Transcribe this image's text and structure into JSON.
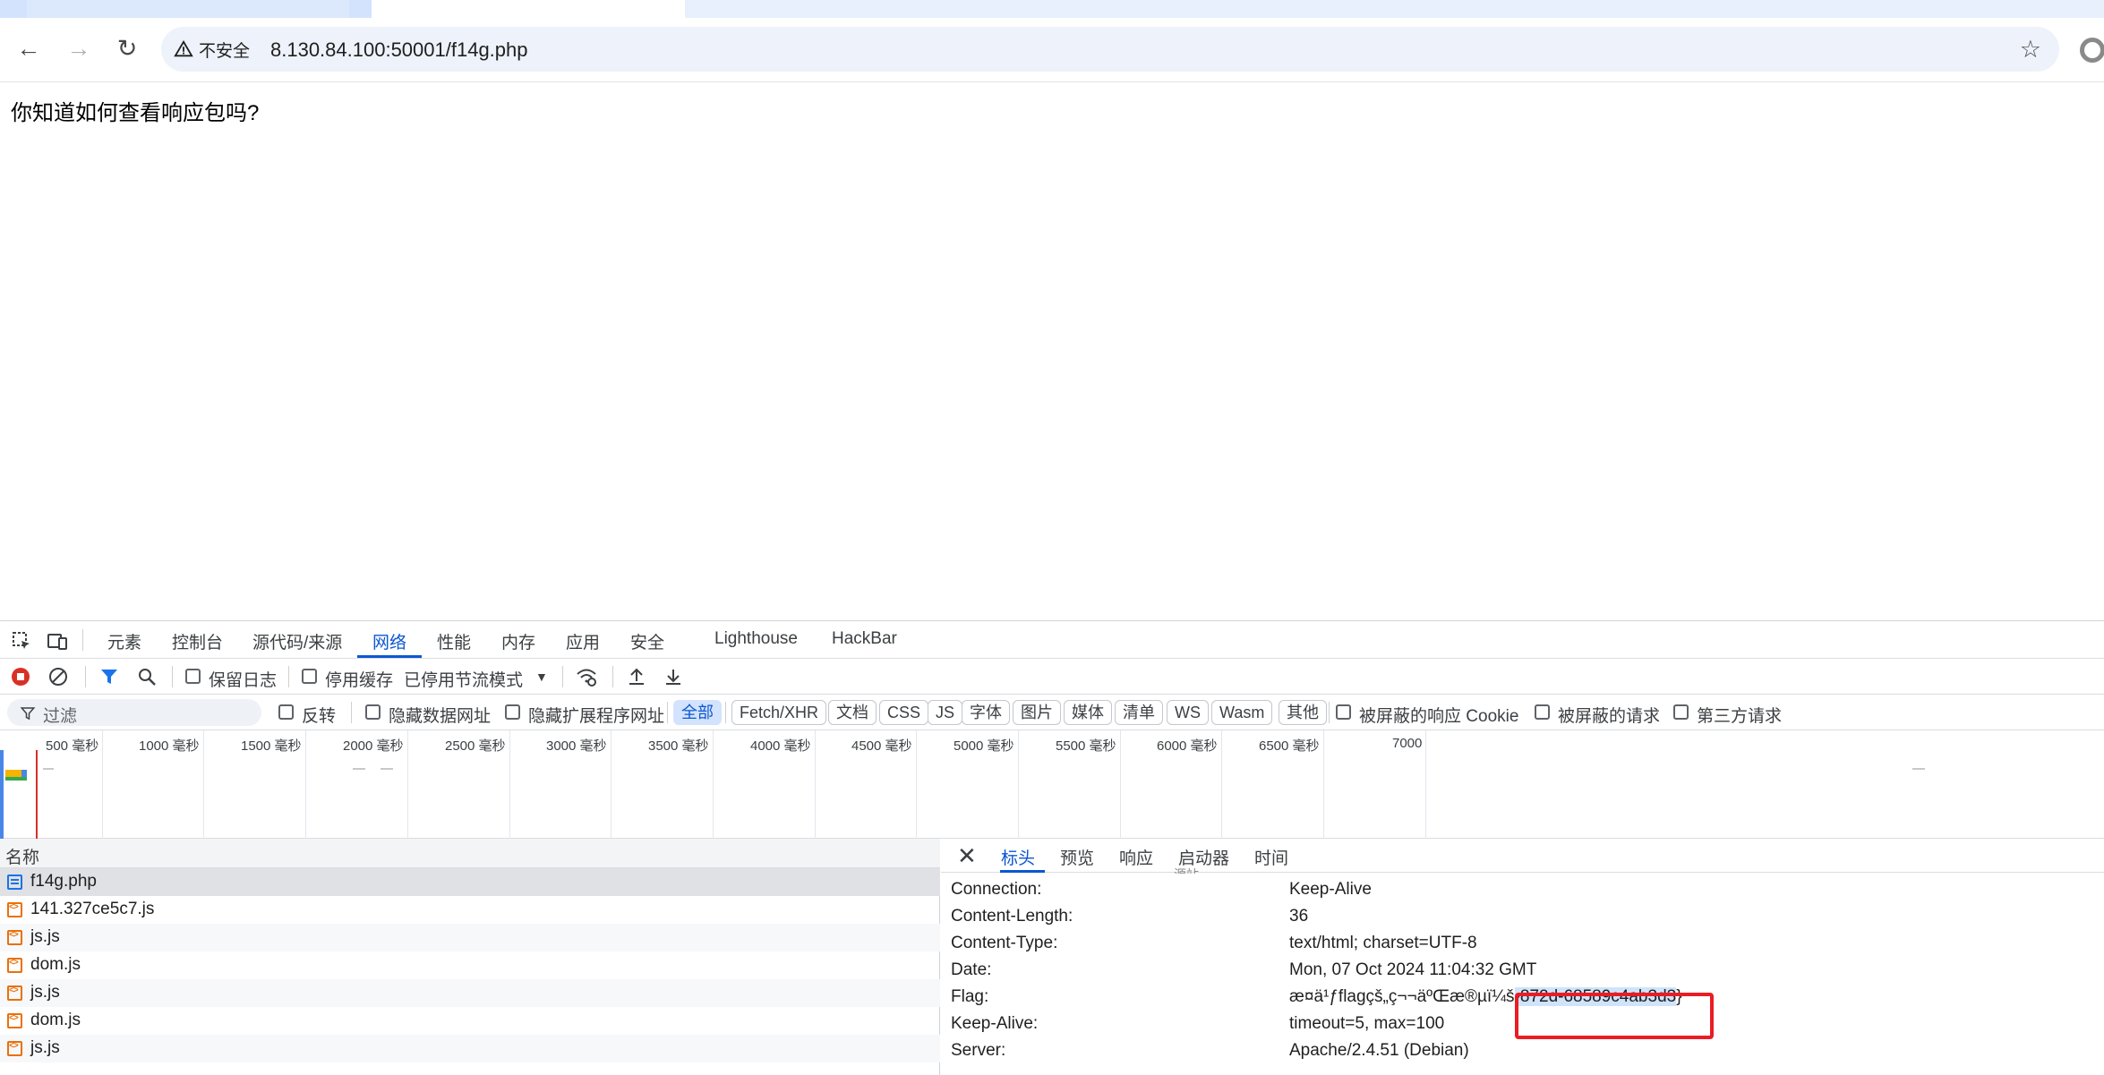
{
  "browser": {
    "security_label": "不安全",
    "url": "8.130.84.100:50001/f14g.php"
  },
  "page": {
    "text": "你知道如何查看响应包吗?"
  },
  "devtools": {
    "tabs": [
      "元素",
      "控制台",
      "源代码/来源",
      "网络",
      "性能",
      "内存",
      "应用",
      "安全",
      "Lighthouse",
      "HackBar"
    ],
    "active_tab": "网络",
    "toolbar": {
      "preserve_log": "保留日志",
      "disable_cache": "停用缓存",
      "throttling": "已停用节流模式"
    },
    "filter": {
      "placeholder": "过滤",
      "invert": "反转",
      "hide_data_urls": "隐藏数据网址",
      "hide_extension_urls": "隐藏扩展程序网址",
      "types": [
        "全部",
        "Fetch/XHR",
        "文档",
        "CSS",
        "JS",
        "字体",
        "图片",
        "媒体",
        "清单",
        "WS",
        "Wasm",
        "其他"
      ],
      "active_type": "全部",
      "blocked_cookies": "被屏蔽的响应 Cookie",
      "blocked_requests": "被屏蔽的请求",
      "third_party": "第三方请求"
    },
    "overview_ticks": [
      "500 毫秒",
      "1000 毫秒",
      "1500 毫秒",
      "2000 毫秒",
      "2500 毫秒",
      "3000 毫秒",
      "3500 毫秒",
      "4000 毫秒",
      "4500 毫秒",
      "5000 毫秒",
      "5500 毫秒",
      "6000 毫秒",
      "6500 毫秒",
      "7000"
    ],
    "request_list": {
      "header": "名称",
      "rows": [
        {
          "name": "f14g.php",
          "type": "doc"
        },
        {
          "name": "141.327ce5c7.js",
          "type": "js"
        },
        {
          "name": "js.js",
          "type": "js"
        },
        {
          "name": "dom.js",
          "type": "js"
        },
        {
          "name": "js.js",
          "type": "js"
        },
        {
          "name": "dom.js",
          "type": "js"
        },
        {
          "name": "js.js",
          "type": "js"
        }
      ]
    },
    "detail": {
      "tabs": [
        "标头",
        "预览",
        "响应",
        "启动器",
        "时间"
      ],
      "active_tab": "标头",
      "clipped_heading": "源站",
      "headers": [
        {
          "key": "Connection:",
          "value": "Keep-Alive"
        },
        {
          "key": "Content-Length:",
          "value": "36"
        },
        {
          "key": "Content-Type:",
          "value": "text/html; charset=UTF-8"
        },
        {
          "key": "Date:",
          "value": "Mon, 07 Oct 2024 11:04:32 GMT"
        },
        {
          "key": "Flag:",
          "value_plain": "æ¤ä¹ƒflagçš„ç¬¬äºŒæ®µï¼š",
          "value_highlighted": "-872d-68589c4ab3d3",
          "value_tail": "}"
        },
        {
          "key": "Keep-Alive:",
          "value": "timeout=5, max=100"
        },
        {
          "key": "Server:",
          "value": "Apache/2.4.51 (Debian)"
        }
      ]
    }
  },
  "colors": {
    "accent": "#0b57d0",
    "highlight_box": "#ea1c24",
    "selection": "#cfe3fb"
  }
}
